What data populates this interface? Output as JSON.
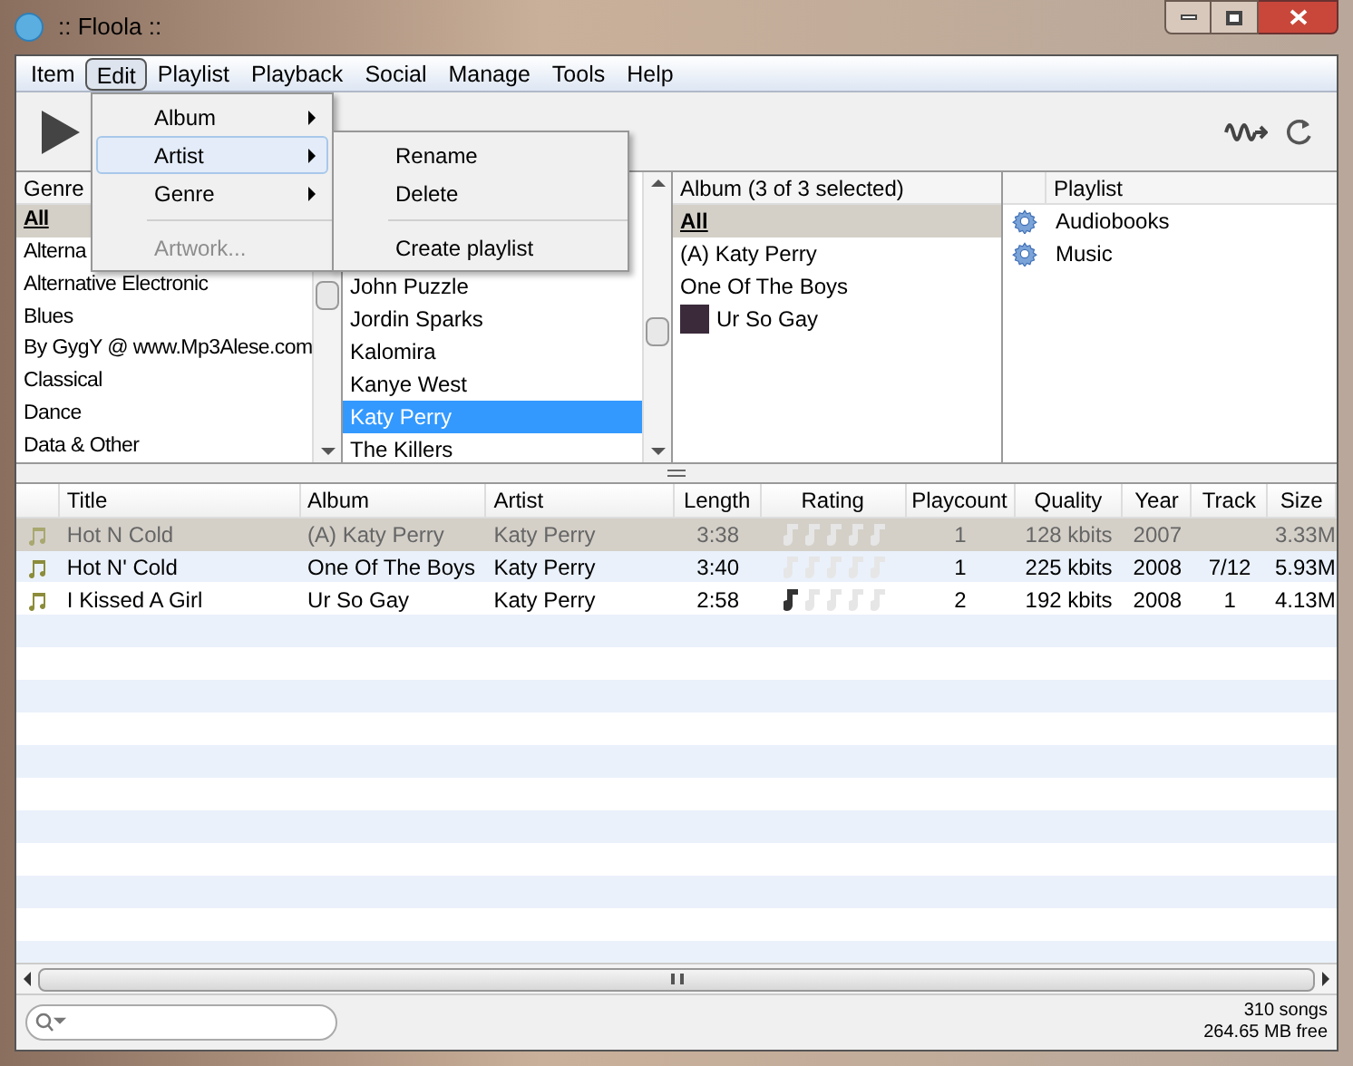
{
  "window": {
    "title": ":: Floola ::"
  },
  "menu_bar": [
    {
      "label": "Item",
      "selected": false
    },
    {
      "label": "Edit",
      "selected": true
    },
    {
      "label": "Playlist",
      "selected": false
    },
    {
      "label": "Playback",
      "selected": false
    },
    {
      "label": "Social",
      "selected": false
    },
    {
      "label": "Manage",
      "selected": false
    },
    {
      "label": "Tools",
      "selected": false
    },
    {
      "label": "Help",
      "selected": false
    }
  ],
  "edit_menu": [
    {
      "kind": "item",
      "label": "Album",
      "has_submenu": true,
      "selected": false,
      "disabled": false
    },
    {
      "kind": "item",
      "label": "Artist",
      "has_submenu": true,
      "selected": true,
      "disabled": false
    },
    {
      "kind": "item",
      "label": "Genre",
      "has_submenu": true,
      "selected": false,
      "disabled": false
    },
    {
      "kind": "separator"
    },
    {
      "kind": "item",
      "label": "Artwork...",
      "has_submenu": false,
      "selected": false,
      "disabled": true
    }
  ],
  "artist_submenu": [
    {
      "kind": "item",
      "label": "Rename"
    },
    {
      "kind": "item",
      "label": "Delete"
    },
    {
      "kind": "separator"
    },
    {
      "kind": "item",
      "label": "Create playlist"
    }
  ],
  "genre_pane": {
    "header": "Genre",
    "items": [
      {
        "label": "All",
        "selected": true
      },
      {
        "label": "Alterna",
        "selected": false
      },
      {
        "label": "Alternative Electronic",
        "selected": false
      },
      {
        "label": "Blues",
        "selected": false
      },
      {
        "label": "By GygY @ www.Mp3Alese.com",
        "selected": false
      },
      {
        "label": "Classical",
        "selected": false
      },
      {
        "label": "Dance",
        "selected": false
      },
      {
        "label": "Data & Other",
        "selected": false
      }
    ]
  },
  "artist_pane": {
    "items": [
      {
        "label": "John Puzzle",
        "selected": false
      },
      {
        "label": "Jordin Sparks",
        "selected": false
      },
      {
        "label": "Kalomira",
        "selected": false
      },
      {
        "label": "Kanye West",
        "selected": false
      },
      {
        "label": "Katy Perry",
        "selected": true
      },
      {
        "label": "The Killers",
        "selected": false
      }
    ]
  },
  "album_pane": {
    "header": "Album (3 of 3 selected)",
    "items": [
      {
        "label": "All",
        "selected": true,
        "thumbnail": false
      },
      {
        "label": "(A) Katy Perry",
        "selected": false,
        "thumbnail": false
      },
      {
        "label": "One Of The Boys",
        "selected": false,
        "thumbnail": false
      },
      {
        "label": "Ur So Gay",
        "selected": false,
        "thumbnail": true
      }
    ]
  },
  "playlist_pane": {
    "header": "Playlist",
    "items": [
      {
        "label": "Audiobooks"
      },
      {
        "label": "Music"
      }
    ]
  },
  "table": {
    "columns": [
      "Title",
      "Album",
      "Artist",
      "Length",
      "Rating",
      "Playcount",
      "Quality",
      "Year",
      "Track",
      "Size"
    ],
    "rows": [
      {
        "selected": true,
        "title": "Hot N Cold",
        "album": "(A) Katy Perry",
        "artist": "Katy Perry",
        "length": "3:38",
        "stars": 0,
        "playcount": "1",
        "quality": "128 kbits",
        "year": "2007",
        "track": "",
        "size": "3.33M"
      },
      {
        "selected": false,
        "title": "Hot N' Cold",
        "album": "One Of The Boys",
        "artist": "Katy Perry",
        "length": "3:40",
        "stars": 0,
        "playcount": "1",
        "quality": "225 kbits",
        "year": "2008",
        "track": "7/12",
        "size": "5.93M"
      },
      {
        "selected": false,
        "title": "I Kissed A Girl",
        "album": "Ur So Gay",
        "artist": "Katy Perry",
        "length": "2:58",
        "stars": 1,
        "playcount": "2",
        "quality": "192 kbits",
        "year": "2008",
        "track": "1",
        "size": "4.13M"
      }
    ]
  },
  "status_bar": {
    "songs": "310 songs",
    "free": "264.65 MB free"
  }
}
